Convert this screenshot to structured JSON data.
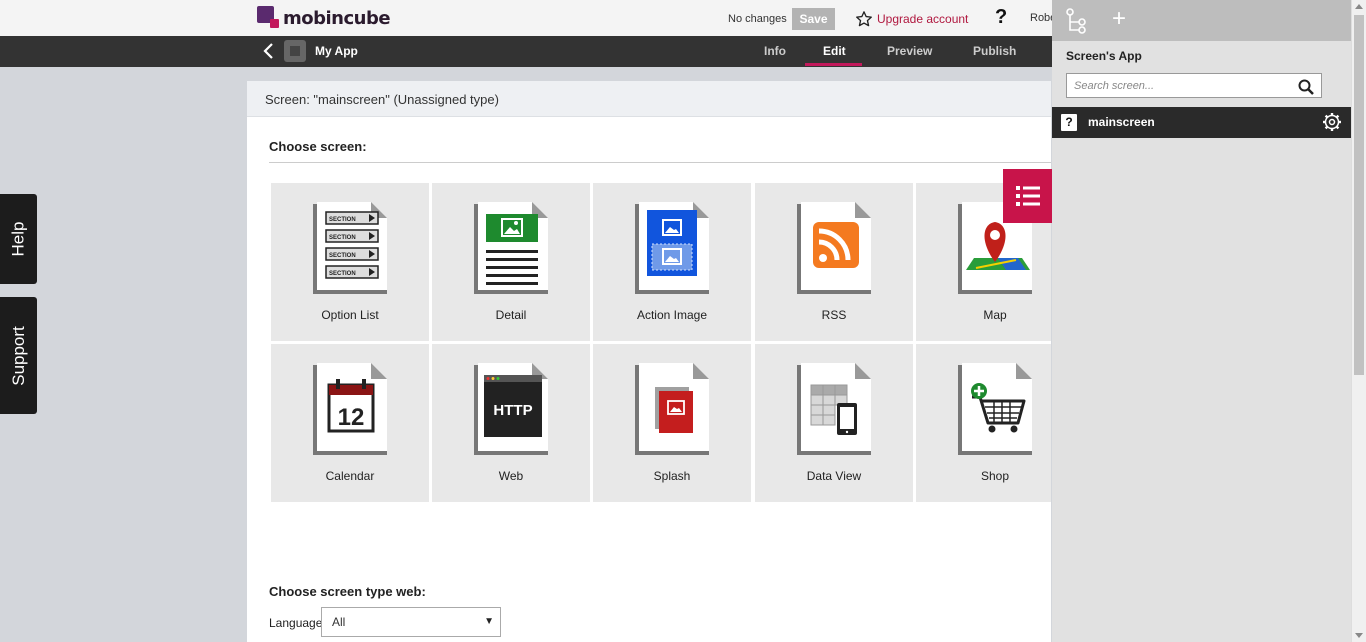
{
  "topbar": {
    "logo_text": "mobincube",
    "status": "No changes",
    "save_label": "Save",
    "upgrade_label": "Upgrade account",
    "help_label": "?",
    "user_label": "Robe"
  },
  "appbar": {
    "app_name": "My App",
    "tabs": [
      {
        "label": "Info"
      },
      {
        "label": "Edit"
      },
      {
        "label": "Preview"
      },
      {
        "label": "Publish"
      }
    ],
    "active_tab": "Edit"
  },
  "side_tabs": {
    "help": "Help",
    "support": "Support"
  },
  "main": {
    "header": "Screen: \"mainscreen\" (Unassigned type)",
    "choose_title": "Choose screen:",
    "tiles": [
      {
        "label": "Option List",
        "icon": "option-list-icon"
      },
      {
        "label": "Detail",
        "icon": "detail-icon"
      },
      {
        "label": "Action Image",
        "icon": "action-image-icon"
      },
      {
        "label": "RSS",
        "icon": "rss-icon"
      },
      {
        "label": "Map",
        "icon": "map-pin-icon"
      },
      {
        "label": "Calendar",
        "icon": "calendar-icon"
      },
      {
        "label": "Web",
        "icon": "web-icon"
      },
      {
        "label": "Splash",
        "icon": "splash-icon"
      },
      {
        "label": "Data View",
        "icon": "data-view-icon"
      },
      {
        "label": "Shop",
        "icon": "shop-cart-icon"
      }
    ],
    "icon_text": {
      "section": "SECTION",
      "calendar_day": "12",
      "http": "HTTP"
    },
    "web_title": "Choose screen type web:",
    "language_label": "Language",
    "language_value": "All"
  },
  "rpanel": {
    "title": "Screen's App",
    "search_placeholder": "Search screen...",
    "items": [
      {
        "label": "mainscreen",
        "icon_glyph": "?"
      }
    ]
  },
  "colors": {
    "accent": "#c2185b",
    "dark_bar": "#333333",
    "tile_bg": "#e8e8e8"
  }
}
